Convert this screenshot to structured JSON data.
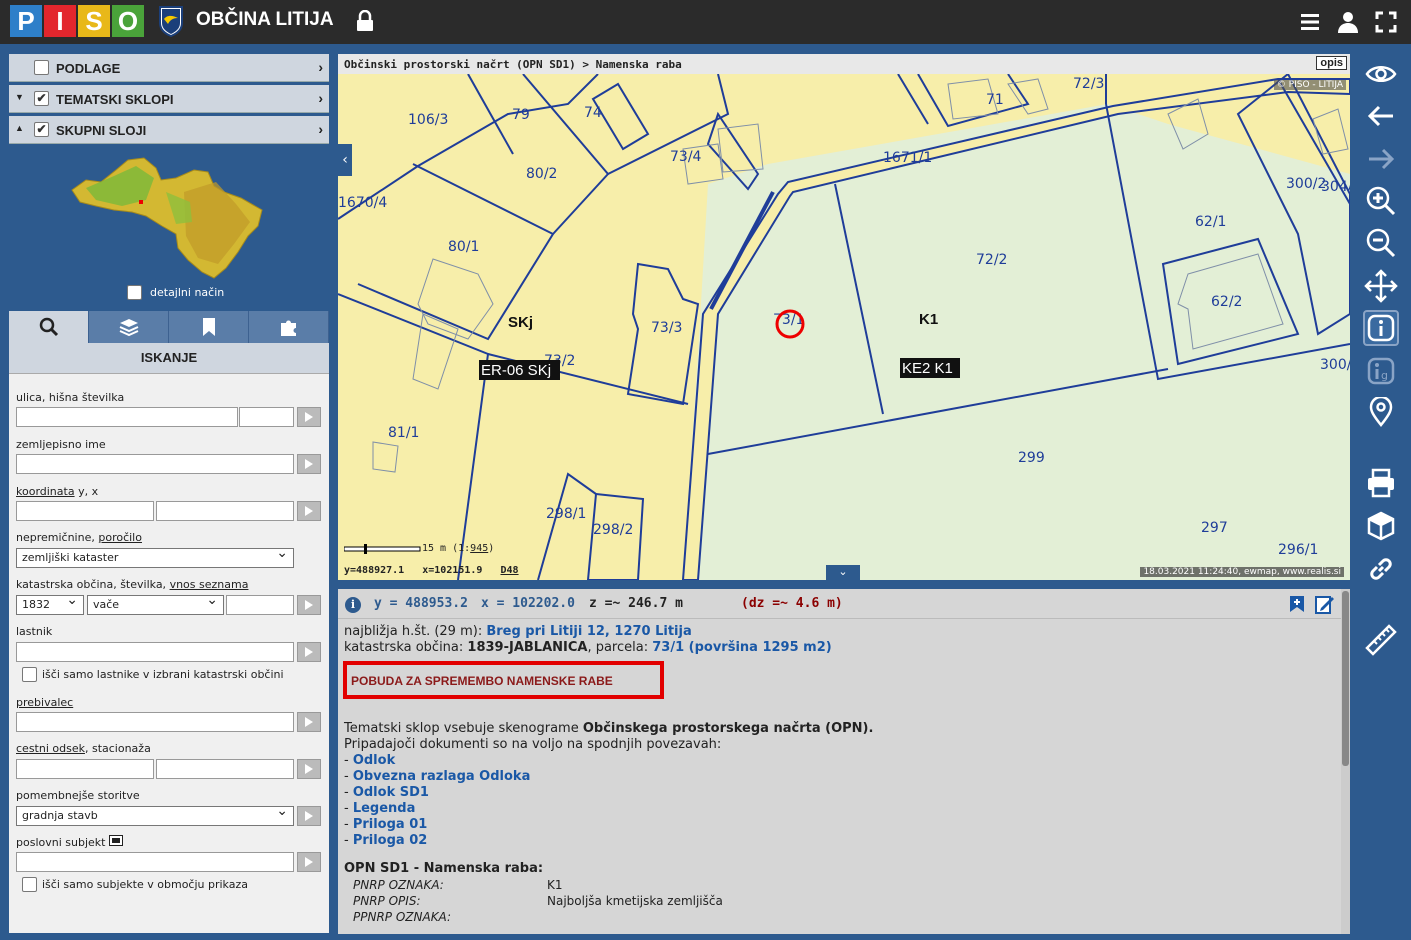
{
  "header": {
    "logo_letters": [
      "P",
      "I",
      "S",
      "O"
    ],
    "logo_colors": [
      "#2e7fc9",
      "#e3262d",
      "#e8b819",
      "#4aa33a"
    ],
    "title": "OBČINA LITIJA",
    "icons": [
      "menu-icon",
      "user-icon",
      "fullscreen-icon"
    ]
  },
  "layers": {
    "podlage": "PODLAGE",
    "tematski": "TEMATSKI SKLOPI",
    "skupni": "SKUPNI SLOJI"
  },
  "minimap": {
    "detail_label": "detajlni način"
  },
  "tabs": [
    "search-icon",
    "layers-icon",
    "bookmark-icon",
    "puzzle-icon"
  ],
  "search": {
    "title": "ISKANJE",
    "ulica_label": "ulica, hišna številka",
    "zemljepisno_label": "zemljepisno ime",
    "koordinata_link": "koordinata",
    "koordinata_rest": " y, x",
    "nepremicnine_label": "nepremičnine, ",
    "porocilo_link": "poročilo",
    "kataster_select": "zemljiški kataster",
    "ko_label": "katastrska občina, številka, ",
    "vnos_link": "vnos seznama",
    "ko_select": "1832",
    "ko_name_select": "vače",
    "lastnik_label": "lastnik",
    "lastnik_check": "išči samo lastnike v izbrani katastrski občini",
    "prebivalec_link": "prebivalec",
    "cestni_link": "cestni odsek",
    "cestni_rest": ", stacionaža",
    "storitve_label": "pomembnejše storitve",
    "storitve_select": "gradnja stavb",
    "subjekt_label": "poslovni subjekt",
    "subjekt_check": "išči samo subjekte v območju prikaza"
  },
  "map": {
    "breadcrumb": "Občinski prostorski načrt (OPN SD1) > Namenska raba",
    "opis": "opis",
    "copyright": "© PISO - LITIJA",
    "timestamp": "18.03.2021 11:24:40, ewmap, www.realis.si",
    "scale_text": "15 m (1:",
    "scale_ratio": "945",
    "scale_close": ")",
    "coord_y": "y=488927.1",
    "coord_x": "x=102151.9",
    "datum": "D48",
    "parcels": [
      "106/3",
      "79",
      "74",
      "71",
      "72/3",
      "73/4",
      "1671/1",
      "80/2",
      "1670/4",
      "80/1",
      "72/2",
      "62/1",
      "300/2",
      "304/",
      "73/1",
      "62/2",
      "73/3",
      "73/2",
      "300/",
      "81/1",
      "299",
      "298/1",
      "298/2",
      "297",
      "296/1"
    ],
    "zone_labels": [
      "SKj",
      "K1"
    ],
    "tag_labels": [
      "ER-06 SKj",
      "KE2 K1"
    ]
  },
  "info": {
    "y": "y = 488953.2",
    "x": "x = 102202.0",
    "z": "z =~ 246.7 m",
    "dz": "(dz =~ 4.6 m)",
    "nearest_label": "najbližja h.št. (29 m): ",
    "nearest_value": "Breg pri Litiji 12, 1270 Litija",
    "ko_label": "katastrska občina: ",
    "ko_value": "1839-JABLANICA",
    "parcela_label": ", parcela: ",
    "parcela_value": "73/1 (površina 1295 m2)",
    "pobuda": "POBUDA ZA SPREMEMBO NAMENSKE RABE",
    "tema_text1": "Tematski sklop vsebuje skenograme ",
    "tema_bold": "Občinskega prostorskega načrta (OPN).",
    "tema_text2": "Pripadajoči dokumenti so na voljo na spodnjih povezavah:",
    "links": [
      "Odlok",
      "Obvezna razlaga Odloka",
      "Odlok SD1",
      "Legenda",
      "Priloga 01",
      "Priloga 02"
    ],
    "opn_title": "OPN SD1 - Namenska raba:",
    "rows": [
      {
        "k": "PNRP OZNAKA:",
        "v": "K1"
      },
      {
        "k": "PNRP OPIS:",
        "v": "Najboljša kmetijska zemljišča"
      },
      {
        "k": "PPNRP OZNAKA:",
        "v": ""
      }
    ]
  },
  "toolbar_right": [
    "eye-icon",
    "arrow-left-icon",
    "arrow-right-icon",
    "zoom-in-icon",
    "zoom-out-icon",
    "pan-icon",
    "info-icon",
    "info-g-icon",
    "location-icon",
    "print-icon",
    "cube-icon",
    "link-icon",
    "ruler-icon"
  ]
}
